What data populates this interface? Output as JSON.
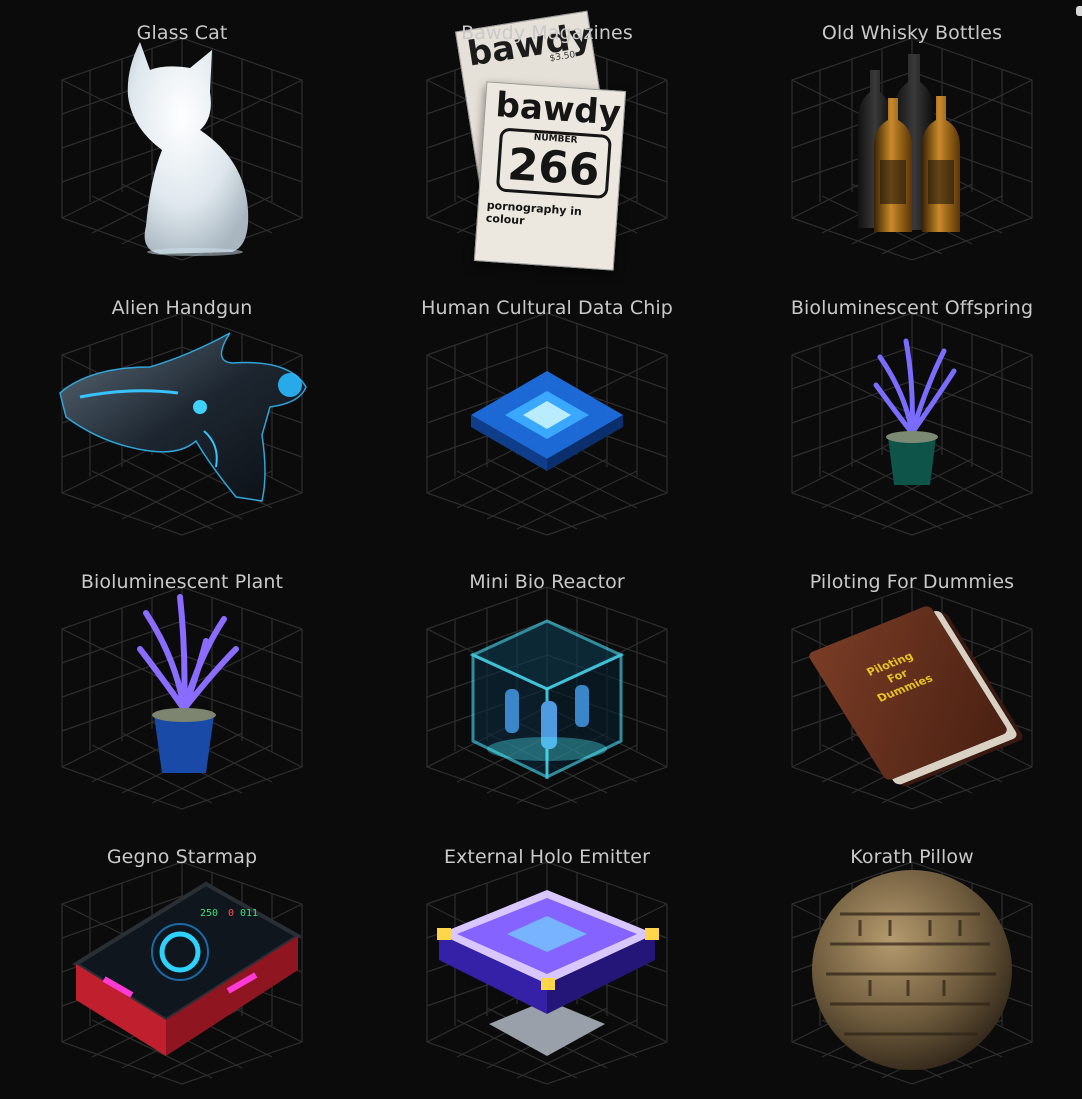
{
  "items": [
    {
      "name": "Glass Cat",
      "icon": "glass-cat-icon"
    },
    {
      "name": "Bawdy Magazines",
      "icon": "magazines-icon",
      "magazine": {
        "brand": "bawdy",
        "number_label": "NUMBER",
        "number": "266",
        "tagline": "pornography in colour",
        "price": "$3.50"
      }
    },
    {
      "name": "Old Whisky Bottles",
      "icon": "whisky-bottles-icon"
    },
    {
      "name": "Alien Handgun",
      "icon": "alien-handgun-icon"
    },
    {
      "name": "Human Cultural Data Chip",
      "icon": "data-chip-icon"
    },
    {
      "name": "Bioluminescent Offspring",
      "icon": "small-plant-icon"
    },
    {
      "name": "Bioluminescent Plant",
      "icon": "plant-icon"
    },
    {
      "name": "Mini Bio Reactor",
      "icon": "bio-reactor-icon"
    },
    {
      "name": "Piloting For Dummies",
      "icon": "book-icon",
      "book": {
        "line1": "Piloting",
        "line2": "For",
        "line3": "Dummies"
      }
    },
    {
      "name": "Gegno Starmap",
      "icon": "starmap-device-icon",
      "display": {
        "readout_a": "250",
        "readout_b": "0",
        "readout_c": "011"
      }
    },
    {
      "name": "External Holo Emitter",
      "icon": "holo-emitter-icon"
    },
    {
      "name": "Korath Pillow",
      "icon": "stone-tablet-icon"
    }
  ]
}
